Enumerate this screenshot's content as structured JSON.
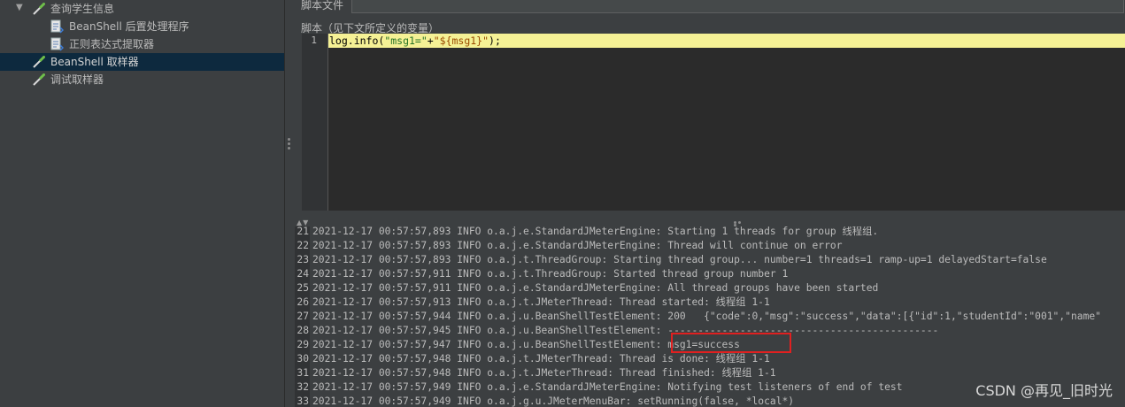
{
  "tree": {
    "items": [
      {
        "label": "查询学生信息",
        "icon": "sampler-pipette-icon"
      },
      {
        "label": "BeanShell 后置处理程序",
        "icon": "script-document-icon"
      },
      {
        "label": "正则表达式提取器",
        "icon": "script-document-icon"
      },
      {
        "label": "BeanShell 取样器",
        "icon": "sampler-pipette-icon",
        "selected": true
      },
      {
        "label": "调试取样器",
        "icon": "sampler-pipette-icon"
      }
    ]
  },
  "panel": {
    "script_file_label": "脚本文件",
    "script_label": "脚本（见下文所定义的变量）"
  },
  "editor": {
    "line_number": "1",
    "code_prefix": "log.info(",
    "code_str1": "\"msg1=\"",
    "code_plus": "+",
    "code_str2": "\"${msg1}\"",
    "code_suffix": ");"
  },
  "log": {
    "lines": [
      {
        "n": "21",
        "text": "2021-12-17 00:57:57,893 INFO o.a.j.e.StandardJMeterEngine: Starting 1 threads for group 线程组."
      },
      {
        "n": "22",
        "text": "2021-12-17 00:57:57,893 INFO o.a.j.e.StandardJMeterEngine: Thread will continue on error"
      },
      {
        "n": "23",
        "text": "2021-12-17 00:57:57,893 INFO o.a.j.t.ThreadGroup: Starting thread group... number=1 threads=1 ramp-up=1 delayedStart=false"
      },
      {
        "n": "24",
        "text": "2021-12-17 00:57:57,911 INFO o.a.j.t.ThreadGroup: Started thread group number 1"
      },
      {
        "n": "25",
        "text": "2021-12-17 00:57:57,911 INFO o.a.j.e.StandardJMeterEngine: All thread groups have been started"
      },
      {
        "n": "26",
        "text": "2021-12-17 00:57:57,913 INFO o.a.j.t.JMeterThread: Thread started: 线程组 1-1"
      },
      {
        "n": "27",
        "text": "2021-12-17 00:57:57,944 INFO o.a.j.u.BeanShellTestElement: 200   {\"code\":0,\"msg\":\"success\",\"data\":[{\"id\":1,\"studentId\":\"001\",\"name\""
      },
      {
        "n": "28",
        "text": "2021-12-17 00:57:57,945 INFO o.a.j.u.BeanShellTestElement: ---------------------------------------------"
      },
      {
        "n": "29",
        "text": "2021-12-17 00:57:57,947 INFO o.a.j.u.BeanShellTestElement: msg1=success"
      },
      {
        "n": "30",
        "text": "2021-12-17 00:57:57,948 INFO o.a.j.t.JMeterThread: Thread is done: 线程组 1-1"
      },
      {
        "n": "31",
        "text": "2021-12-17 00:57:57,948 INFO o.a.j.t.JMeterThread: Thread finished: 线程组 1-1"
      },
      {
        "n": "32",
        "text": "2021-12-17 00:57:57,949 INFO o.a.j.e.StandardJMeterEngine: Notifying test listeners of end of test"
      },
      {
        "n": "33",
        "text": "2021-12-17 00:57:57,949 INFO o.a.j.g.u.JMeterMenuBar: setRunning(false, *local*)"
      }
    ]
  },
  "watermark": "CSDN @再见_旧时光",
  "colors": {
    "background": "#3c3f41",
    "selection": "#0d293e",
    "current_line": "#f5f195",
    "highlight_box": "#e02020"
  }
}
